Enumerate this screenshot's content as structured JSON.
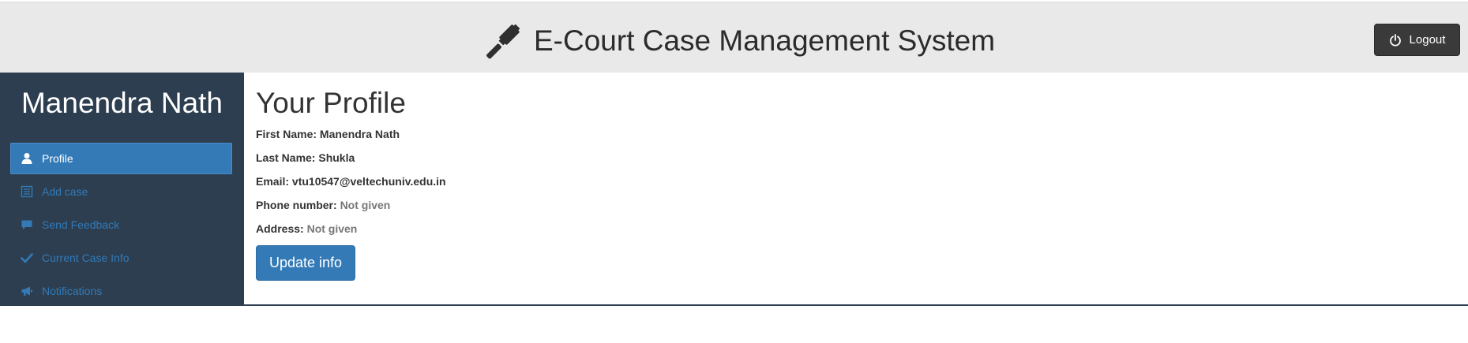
{
  "header": {
    "title": "E-Court Case Management System",
    "logout_label": "Logout",
    "icons": [
      "gavel-icon",
      "power-icon"
    ]
  },
  "sidebar": {
    "user_name": "Manendra Nath",
    "items": [
      {
        "label": "Profile",
        "icon": "user-icon",
        "active": true
      },
      {
        "label": "Add case",
        "icon": "list-icon",
        "active": false
      },
      {
        "label": "Send Feedback",
        "icon": "comment-icon",
        "active": false
      },
      {
        "label": "Current Case Info",
        "icon": "check-icon",
        "active": false
      },
      {
        "label": "Notifications",
        "icon": "bullhorn-icon",
        "active": false
      }
    ]
  },
  "profile": {
    "heading": "Your Profile",
    "first_name_label": "First Name:",
    "first_name": "Manendra Nath",
    "last_name_label": "Last Name:",
    "last_name": "Shukla",
    "email_label": "Email:",
    "email": "vtu10547@veltechuniv.edu.in",
    "phone_label": "Phone number:",
    "phone": "Not given",
    "address_label": "Address:",
    "address": "Not given",
    "update_label": "Update info"
  },
  "colors": {
    "header_bg": "#e9e9e9",
    "sidebar_bg": "#2c3e50",
    "primary": "#337ab7",
    "logout_bg": "#3a3a3a",
    "muted_text": "#777777"
  }
}
